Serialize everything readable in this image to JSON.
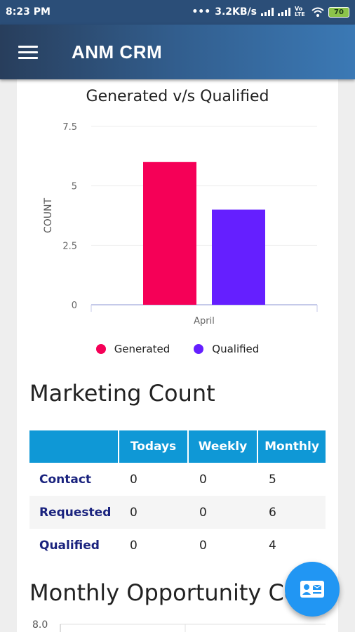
{
  "status_bar": {
    "time": "8:23 PM",
    "network_speed": "3.2KB/s",
    "volte": "Vo LTE",
    "battery": "70",
    "icons": [
      "signal-icon",
      "signal-icon",
      "wifi-icon",
      "battery-icon"
    ]
  },
  "app_bar": {
    "title": "ANM CRM",
    "menu_icon": "hamburger-menu-icon"
  },
  "chart_data": {
    "type": "bar",
    "title": "Generated v/s Qualified",
    "categories": [
      "April"
    ],
    "series": [
      {
        "name": "Generated",
        "values": [
          6
        ],
        "color": "#f50057"
      },
      {
        "name": "Qualified",
        "values": [
          4
        ],
        "color": "#651fff"
      }
    ],
    "ylabel": "COUNT",
    "xlabel": "",
    "ylim": [
      0,
      7.5
    ],
    "yticks": [
      "7.5",
      "5",
      "2.5",
      "0"
    ],
    "yticks_values": [
      7.5,
      5,
      2.5,
      0
    ],
    "grid": true,
    "legend_position": "bottom"
  },
  "marketing_count": {
    "title": "Marketing Count",
    "columns": [
      "",
      "Todays",
      "Weekly",
      "Monthly"
    ],
    "rows": [
      {
        "label": "Contact",
        "todays": "0",
        "weekly": "0",
        "monthly": "5"
      },
      {
        "label": "Requested",
        "todays": "0",
        "weekly": "0",
        "monthly": "6"
      },
      {
        "label": "Qualified",
        "todays": "0",
        "weekly": "0",
        "monthly": "4"
      }
    ]
  },
  "monthly_opportunity": {
    "title": "Monthly Opportunity Count",
    "first_tick": "8.0"
  },
  "fab": {
    "icon": "contact-card-icon",
    "color": "#2196f3"
  }
}
